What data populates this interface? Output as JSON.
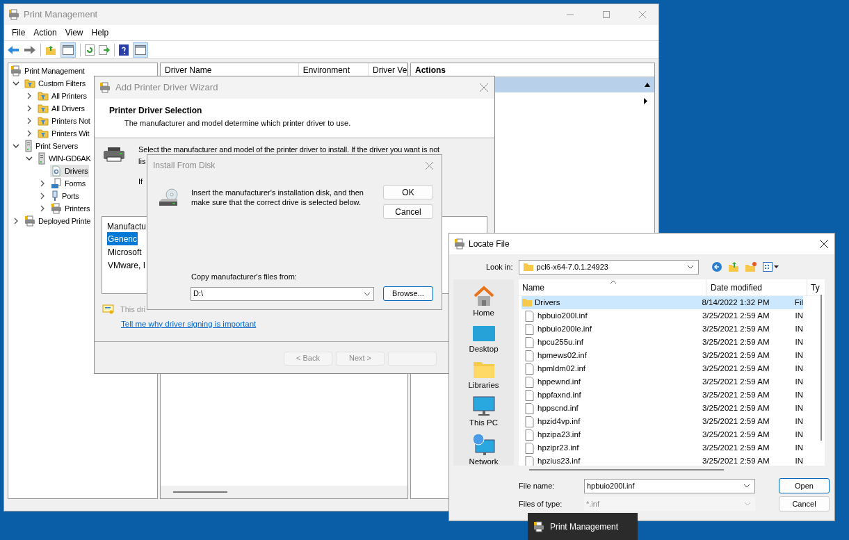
{
  "print_management": {
    "title": "Print Management",
    "menu": [
      "File",
      "Action",
      "View",
      "Help"
    ],
    "tree": [
      {
        "label": "Print Management",
        "kind": "printer",
        "selected": false,
        "children": [
          {
            "label": "Custom Filters",
            "kind": "filter",
            "selected": false,
            "expanded": true,
            "children": [
              {
                "label": "All Printers",
                "kind": "filter",
                "selected": false,
                "expanded": false
              },
              {
                "label": "All Drivers",
                "kind": "filter",
                "selected": false,
                "expanded": false
              },
              {
                "label": "Printers Not",
                "kind": "filter",
                "selected": false,
                "expanded": false
              },
              {
                "label": "Printers Wit",
                "kind": "filter",
                "selected": false,
                "expanded": false
              }
            ]
          },
          {
            "label": "Print Servers",
            "kind": "server",
            "selected": false,
            "expanded": true,
            "children": [
              {
                "label": "WIN-GD6AK",
                "kind": "server",
                "selected": false,
                "expanded": true,
                "children": [
                  {
                    "label": "Drivers",
                    "kind": "drivers",
                    "selected": true
                  },
                  {
                    "label": "Forms",
                    "kind": "forms",
                    "selected": false,
                    "expanded": false
                  },
                  {
                    "label": "Ports",
                    "kind": "ports",
                    "selected": false,
                    "expanded": false
                  },
                  {
                    "label": "Printers",
                    "kind": "printer",
                    "selected": false,
                    "expanded": false
                  }
                ]
              }
            ]
          },
          {
            "label": "Deployed Printe",
            "kind": "printer",
            "selected": false,
            "expanded": false
          }
        ]
      }
    ],
    "columns": [
      "Driver Name",
      "Environment",
      "Driver Ve"
    ],
    "actions": {
      "title": "Actions"
    }
  },
  "wizard": {
    "title": "Add Printer Driver Wizard",
    "heading": "Printer Driver Selection",
    "subheading": "The manufacturer and model determine which printer driver to use.",
    "instruction": "Select the manufacturer and model of the printer driver to install. If the driver you want is not",
    "instruction_line2": "lis",
    "instruction_line3": "If",
    "manufacturers": {
      "header": "Manufactu",
      "items": [
        {
          "label": "Generic",
          "selected": true
        },
        {
          "label": "Microsoft",
          "selected": false
        },
        {
          "label": "VMware, I",
          "selected": false
        }
      ]
    },
    "signing_note": "This dri",
    "link": "Tell me why driver signing is important",
    "buttons": [
      {
        "label": "< Back",
        "disabled": true
      },
      {
        "label": "Next >",
        "disabled": true
      }
    ]
  },
  "install_from_disk": {
    "title": "Install From Disk",
    "message": "Insert the manufacturer's installation disk, and then make sure that the correct drive is selected below.",
    "ok": "OK",
    "cancel": "Cancel",
    "copy_label": "Copy manufacturer's files from:",
    "copy_value": "D:\\",
    "browse": "Browse..."
  },
  "locate_file": {
    "title": "Locate File",
    "look_in_label": "Look in:",
    "look_in": "pcl6-x64-7.0.1.24923",
    "places": [
      {
        "label": "Home",
        "kind": "home"
      },
      {
        "label": "Desktop",
        "kind": "desktop"
      },
      {
        "label": "Libraries",
        "kind": "libraries"
      },
      {
        "label": "This PC",
        "kind": "pc"
      },
      {
        "label": "Network",
        "kind": "network"
      }
    ],
    "columns": [
      "Name",
      "Date modified",
      "Ty"
    ],
    "rows": [
      {
        "name": "Drivers",
        "date": "8/14/2022 1:32 PM",
        "type": "Fil",
        "kind": "folder",
        "selected": true
      },
      {
        "name": "hpbuio200l.inf",
        "date": "3/25/2021 2:59 AM",
        "type": "IN",
        "kind": "file",
        "selected": false
      },
      {
        "name": "hpbuio200le.inf",
        "date": "3/25/2021 2:59 AM",
        "type": "IN",
        "kind": "file",
        "selected": false
      },
      {
        "name": "hpcu255u.inf",
        "date": "3/25/2021 2:59 AM",
        "type": "IN",
        "kind": "file",
        "selected": false
      },
      {
        "name": "hpmews02.inf",
        "date": "3/25/2021 2:59 AM",
        "type": "IN",
        "kind": "file",
        "selected": false
      },
      {
        "name": "hpmldm02.inf",
        "date": "3/25/2021 2:59 AM",
        "type": "IN",
        "kind": "file",
        "selected": false
      },
      {
        "name": "hppewnd.inf",
        "date": "3/25/2021 2:59 AM",
        "type": "IN",
        "kind": "file",
        "selected": false
      },
      {
        "name": "hppfaxnd.inf",
        "date": "3/25/2021 2:59 AM",
        "type": "IN",
        "kind": "file",
        "selected": false
      },
      {
        "name": "hppscnd.inf",
        "date": "3/25/2021 2:59 AM",
        "type": "IN",
        "kind": "file",
        "selected": false
      },
      {
        "name": "hpzid4vp.inf",
        "date": "3/25/2021 2:59 AM",
        "type": "IN",
        "kind": "file",
        "selected": false
      },
      {
        "name": "hpzipa23.inf",
        "date": "3/25/2021 2:59 AM",
        "type": "IN",
        "kind": "file",
        "selected": false
      },
      {
        "name": "hpzipr23.inf",
        "date": "3/25/2021 2:59 AM",
        "type": "IN",
        "kind": "file",
        "selected": false
      },
      {
        "name": "hpzius23.inf",
        "date": "3/25/2021 2:59 AM",
        "type": "IN",
        "kind": "file",
        "selected": false
      }
    ],
    "file_name_label": "File name:",
    "file_name": "hpbuio200l.inf",
    "file_type_label": "Files of type:",
    "file_type": "*.inf",
    "open": "Open",
    "cancel": "Cancel"
  },
  "taskbar_tooltip": "Print Management"
}
